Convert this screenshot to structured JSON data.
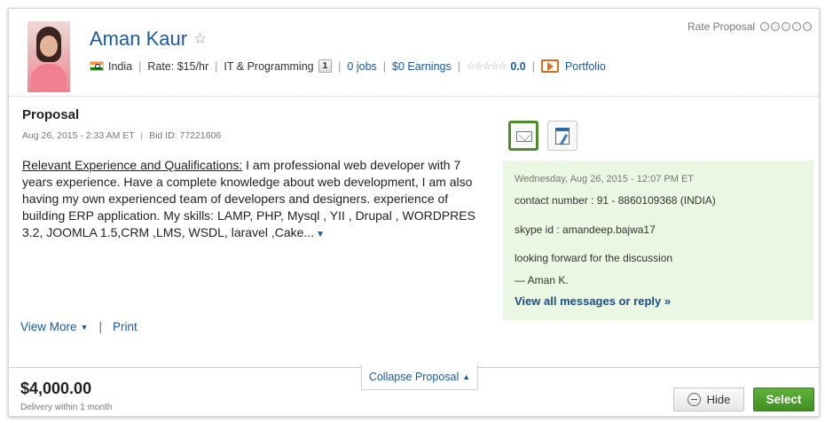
{
  "freelancer": {
    "name": "Aman Kaur",
    "country": "India",
    "rate": "Rate: $15/hr",
    "category": "IT & Programming",
    "category_badge": "1",
    "jobs": "0 jobs",
    "earnings": "$0 Earnings",
    "rating_value": "0.0",
    "portfolio_label": "Portfolio"
  },
  "rate_proposal": {
    "label": "Rate Proposal",
    "rating": 0,
    "max": 5
  },
  "proposal": {
    "title": "Proposal",
    "date": "Aug 26, 2015 - 2:33 AM ET",
    "bid_id": "Bid ID: 77221606",
    "cover_heading": "Relevant Experience and Qualifications:",
    "cover_text": " I am professional web developer with 7 years experience. Have a complete knowledge about web development, I am also having my own experienced team of developers and designers. experience of building ERP application. My skills: LAMP, PHP, Mysql , YII , Drupal , WORDPRES 3.2, JOOMLA 1.5,CRM ,LMS, WSDL, laravel ,Cake...",
    "more_arrow": "▼",
    "view_more": "View More",
    "print": "Print",
    "collapse": "Collapse Proposal",
    "amount": "$4,000.00",
    "delivery": "Delivery within 1 month"
  },
  "message": {
    "date": "Wednesday, Aug 26, 2015 - 12:07 PM ET",
    "line1": "contact number : 91 - 8860109368 (INDIA)",
    "line2": "skype id : amandeep.bajwa17",
    "line3": "looking forward for the discussion",
    "signature": "— Aman K.",
    "view_all": "View all messages or reply »"
  },
  "actions": {
    "hide": "Hide",
    "select": "Select"
  },
  "icons": {
    "star": "☆",
    "rating_stars": "☆☆☆☆☆",
    "caret_down": "▼",
    "caret_up": "▲"
  },
  "colors": {
    "link": "#1a5aa0",
    "select_green": "#4f9a2d",
    "message_bg": "#eaf7e2"
  }
}
